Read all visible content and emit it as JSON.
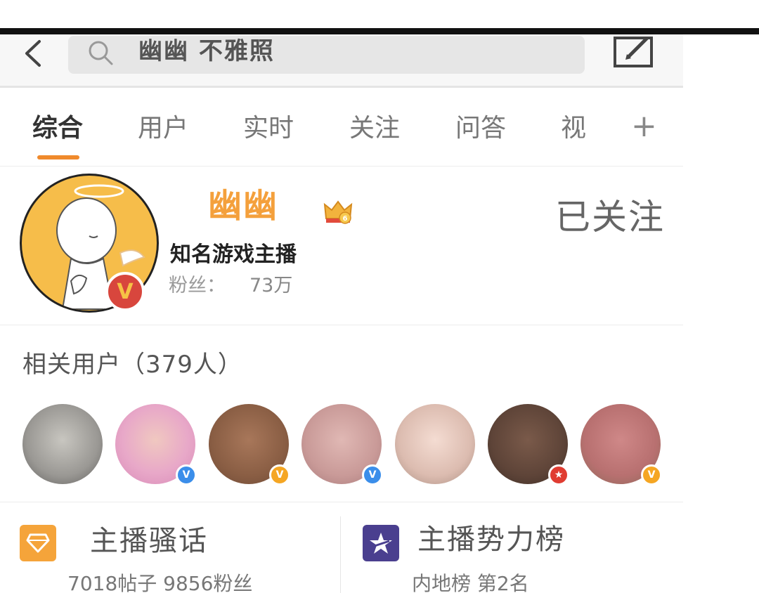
{
  "search": {
    "query": "幽幽 不雅照"
  },
  "tabs": [
    {
      "label": "综合",
      "active": true
    },
    {
      "label": "用户",
      "active": false
    },
    {
      "label": "实时",
      "active": false
    },
    {
      "label": "关注",
      "active": false
    },
    {
      "label": "问答",
      "active": false
    },
    {
      "label": "视",
      "active": false
    }
  ],
  "tab_more_label": "+",
  "profile": {
    "name": "幽幽",
    "follow_status": "已关注",
    "description": "知名游戏主播",
    "fans_label": "粉丝：",
    "fans_value": "73万",
    "verified_badge": "V",
    "crown_level": "6"
  },
  "related_users": {
    "title": "相关用户（379人）",
    "users": [
      {
        "badge": "",
        "badge_color": ""
      },
      {
        "badge": "V",
        "badge_color": "#3b8eea"
      },
      {
        "badge": "V",
        "badge_color": "#f5a623"
      },
      {
        "badge": "V",
        "badge_color": "#3b8eea"
      },
      {
        "badge": "",
        "badge_color": ""
      },
      {
        "badge": "★",
        "badge_color": "#e03c31"
      },
      {
        "badge": "V",
        "badge_color": "#f5a623"
      }
    ]
  },
  "cards": [
    {
      "icon": "diamond-icon",
      "icon_color": "#f5a43a",
      "title": "主播骚话",
      "subtitle": "7018帖子  9856粉丝"
    },
    {
      "icon": "star-icon",
      "icon_color": "#4a3f8f",
      "title": "主播势力榜",
      "subtitle": "内地榜 第2名"
    }
  ],
  "colors": {
    "accent": "#f08a2c",
    "name": "#f4a03c"
  }
}
